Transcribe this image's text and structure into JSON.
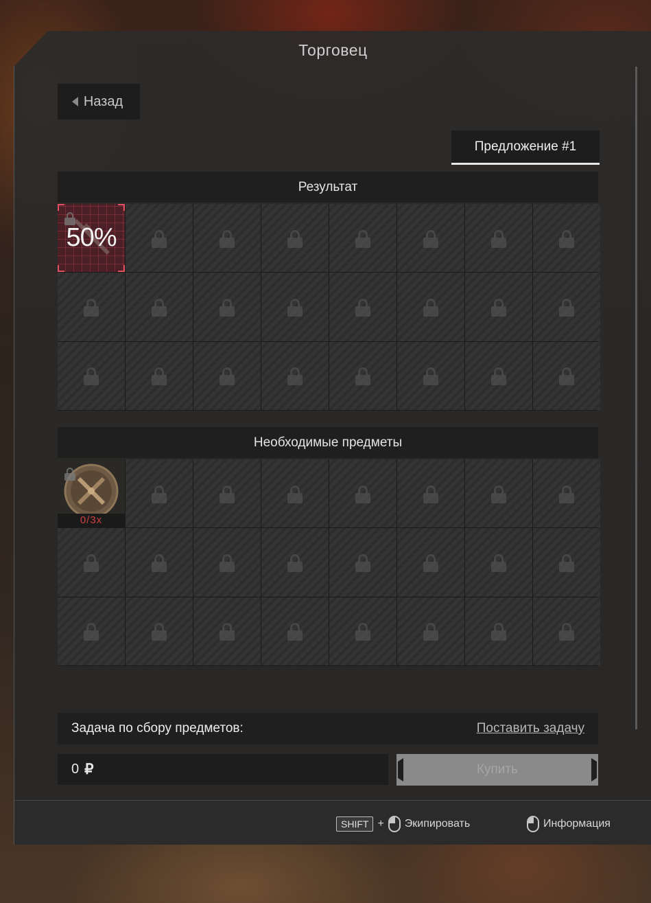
{
  "window": {
    "title": "Торговец"
  },
  "back_button": {
    "label": "Назад"
  },
  "offer_tab": {
    "label": "Предложение #1"
  },
  "result": {
    "header": "Результат",
    "item": {
      "percent": "50%",
      "icon": "rifle-icon",
      "locked": true
    }
  },
  "required": {
    "header": "Необходимые предметы",
    "item": {
      "quantity": "0/3x",
      "icon": "crossed-tools-badge-icon",
      "locked": true
    }
  },
  "task": {
    "label": "Задача по сбору предметов:",
    "action": "Поставить задачу"
  },
  "price": {
    "value": "0",
    "currency": "₽"
  },
  "buy_button": {
    "label": "Купить"
  },
  "footer": {
    "shift_key": "SHIFT",
    "plus": "+",
    "equip_label": "Экипировать",
    "info_label": "Информация"
  },
  "colors": {
    "accent_red": "#d04040",
    "panel": "#2c2b2a"
  }
}
